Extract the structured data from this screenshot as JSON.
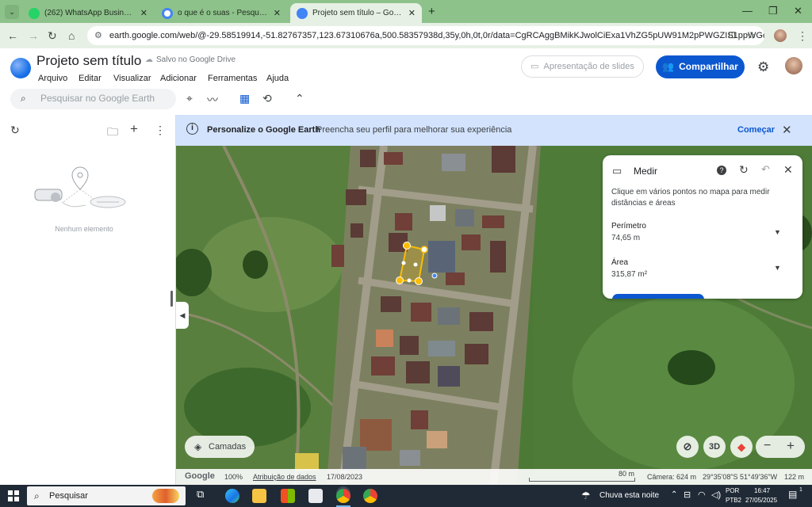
{
  "browser": {
    "tabs": [
      {
        "label": "(262) WhatsApp Business",
        "close": "✕",
        "active": false,
        "color": "#25d366"
      },
      {
        "label": "o que é o suas - Pesquisa Google",
        "close": "✕",
        "active": false,
        "color": "#ffffff"
      },
      {
        "label": "Projeto sem título – Google Earth",
        "close": "✕",
        "active": true,
        "color": "#4285f4"
      }
    ],
    "new_tab": "+",
    "url": "earth.google.com/web/@-29.58519914,-51.82767357,123.67310676a,500.58357938d,35y,0h,0t,0r/data=CgRCAggBMikKJwolCiExa1VhZG5pUW91M2pPWGZIS1ppWGdydl9DN...",
    "window_controls": [
      "—",
      "❐",
      "✕"
    ]
  },
  "app": {
    "title": "Projeto sem título",
    "saved_status": "Salvo no Google Drive",
    "menu": [
      "Arquivo",
      "Editar",
      "Visualizar",
      "Adicionar",
      "Ferramentas",
      "Ajuda"
    ],
    "slides_label": "Apresentação de slides",
    "share_label": "Compartilhar",
    "search_placeholder": "Pesquisar no Google Earth"
  },
  "left_panel": {
    "empty_label": "Nenhum elemento"
  },
  "banner": {
    "title": "Personalize o Google Earth",
    "text": "Preencha seu perfil para melhorar sua experiência",
    "cta": "Começar",
    "close": "✕"
  },
  "measure": {
    "title": "Medir",
    "hint": "Clique em vários pontos no mapa para medir distâncias e áreas",
    "perimeter_label": "Perímetro",
    "perimeter_value": "74,65 m",
    "area_label": "Área",
    "area_value": "315,87 m²"
  },
  "map_controls": {
    "layers_label": "Camadas",
    "three_d_label": "3D",
    "zoom_out": "−",
    "zoom_in": "+"
  },
  "statusbar": {
    "brand": "Google",
    "zoom_pct": "100%",
    "attribution": "Atribuição de dados",
    "date": "17/08/2023",
    "scale": "80 m",
    "camera": "Câmera: 624 m",
    "coords": "29°35'08\"S 51°49'36\"W",
    "elevation": "122 m"
  },
  "taskbar": {
    "search_label": "Pesquisar",
    "weather": "Chuva esta noite",
    "lang": "POR",
    "layout": "PTB2",
    "time": "16:47",
    "date": "27/05/2025",
    "notif_count": "1"
  },
  "colors": {
    "accent": "#0b57d0",
    "chrome": "#8ec28b",
    "banner": "#d3e3fd",
    "measure_line": "#fbbc04"
  }
}
